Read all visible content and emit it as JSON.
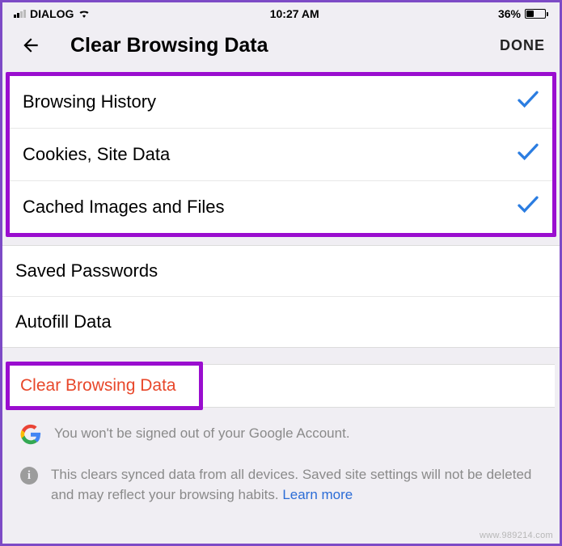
{
  "statusBar": {
    "carrier": "DIALOG",
    "time": "10:27 AM",
    "batteryPercent": "36%"
  },
  "header": {
    "title": "Clear Browsing Data",
    "doneLabel": "DONE"
  },
  "options": {
    "browsingHistory": "Browsing History",
    "cookies": "Cookies, Site Data",
    "cached": "Cached Images and Files",
    "savedPasswords": "Saved Passwords",
    "autofill": "Autofill Data"
  },
  "clearButton": "Clear Browsing Data",
  "googleNote": "You won't be signed out of your Google Account.",
  "syncNote": "This clears synced data from all devices. Saved site settings will not be deleted and may reflect your browsing habits. ",
  "learnMore": "Learn more",
  "watermark": "www.989214.com"
}
